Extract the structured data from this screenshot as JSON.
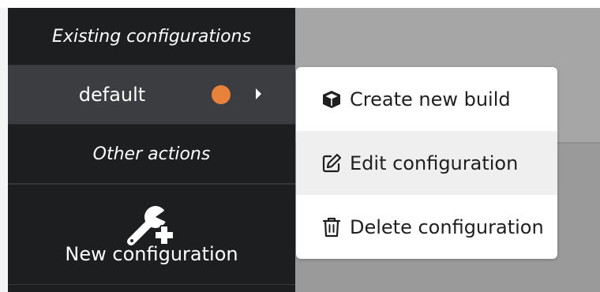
{
  "sidebar": {
    "existing_header": "Existing configurations",
    "configurations": [
      {
        "label": "default",
        "status_color": "#e8823b"
      }
    ],
    "other_header": "Other actions",
    "new_configuration_label": "New configuration"
  },
  "context_menu": {
    "items": [
      {
        "label": "Create new build",
        "icon": "cube-icon"
      },
      {
        "label": "Edit configuration",
        "icon": "edit-icon"
      },
      {
        "label": "Delete configuration",
        "icon": "trash-icon"
      }
    ]
  },
  "colors": {
    "sidebar_bg": "#1d1e20",
    "selected_item_bg": "#3b3d40",
    "status_dot": "#e8823b",
    "menu_hover_bg": "#efefef"
  }
}
